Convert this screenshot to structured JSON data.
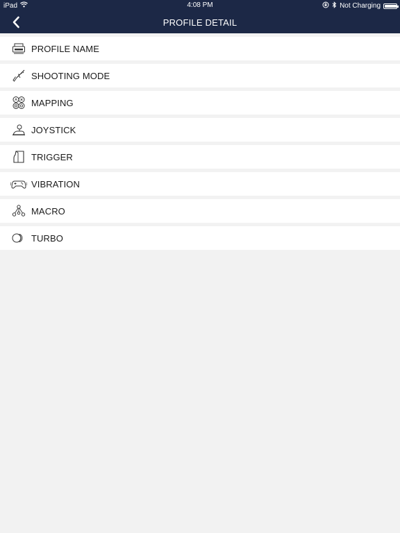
{
  "status_bar": {
    "device": "iPad",
    "time": "4:08 PM",
    "charging": "Not Charging"
  },
  "nav": {
    "title": "PROFILE DETAIL"
  },
  "items": [
    {
      "label": "PROFILE NAME",
      "icon": "profile-card-icon"
    },
    {
      "label": "SHOOTING MODE",
      "icon": "rifle-icon"
    },
    {
      "label": "MAPPING",
      "icon": "button-mapping-icon"
    },
    {
      "label": "JOYSTICK",
      "icon": "joystick-icon"
    },
    {
      "label": "TRIGGER",
      "icon": "trigger-icon"
    },
    {
      "label": "VIBRATION",
      "icon": "gamepad-vibration-icon"
    },
    {
      "label": "MACRO",
      "icon": "macro-nodes-icon"
    },
    {
      "label": "TURBO",
      "icon": "turbo-icon"
    }
  ],
  "colors": {
    "header_bg": "#1c2846",
    "page_bg": "#f2f2f2",
    "row_bg": "#ffffff"
  }
}
